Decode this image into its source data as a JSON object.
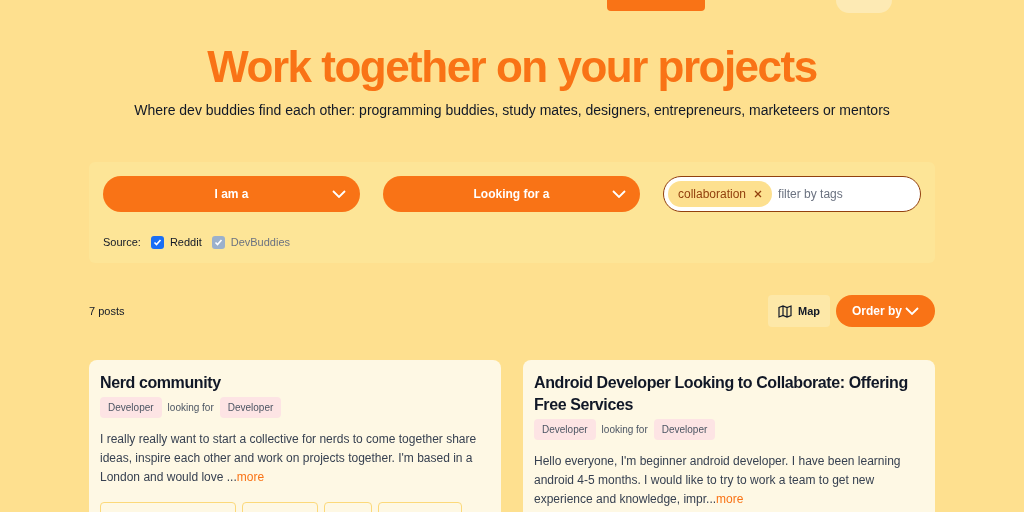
{
  "hero": {
    "title": "Work together on your projects",
    "subtitle": "Where dev buddies find each other: programming buddies, study mates, designers, entrepreneurs, marketeers or mentors"
  },
  "filters": {
    "dropdowns": [
      "I am a",
      "Looking for a"
    ],
    "tags": [
      {
        "label": "collaboration"
      }
    ],
    "tag_placeholder": "filter by tags",
    "source_label": "Source:",
    "sources": [
      {
        "label": "Reddit",
        "checked": true,
        "disabled": false
      },
      {
        "label": "DevBuddies",
        "checked": true,
        "disabled": true
      }
    ]
  },
  "toolbar": {
    "count": "7 posts",
    "map_button": "Map",
    "order_button": "Order by"
  },
  "posts": [
    {
      "title": "Nerd community",
      "role": "Developer",
      "looking_for_label": "looking for",
      "looking_for": "Developer",
      "excerpt": "I really really want to start a collective for nerds to come together share ideas, inspire each other and work on projects together. I'm based in a London and would love ...",
      "more": "more",
      "tags_visible": true
    },
    {
      "title": "Android Developer Looking to Collaborate: Offering Free Services",
      "role": "Developer",
      "looking_for_label": "looking for",
      "looking_for": "Developer",
      "excerpt": "Hello everyone, I'm beginner android developer. I have been learning android 4-5 months. I would like to try to work a team to get new experience and knowledge, impr...",
      "more": "more"
    }
  ]
}
